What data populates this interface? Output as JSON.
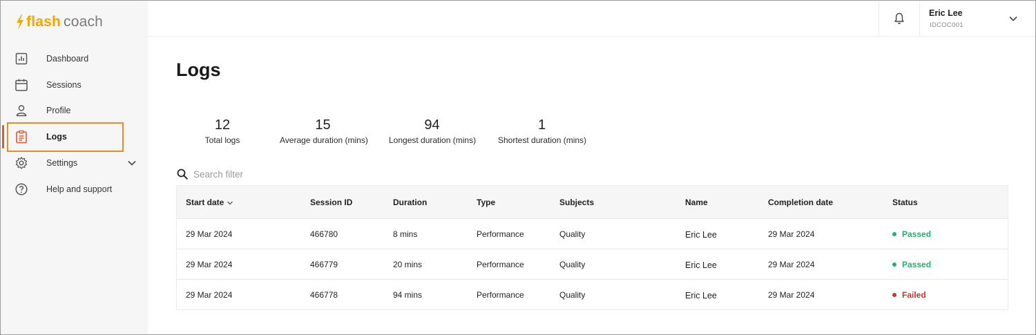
{
  "app": {
    "logo_flash": "flash",
    "logo_coach": "coach",
    "brand_color": "#f5a400"
  },
  "sidebar": {
    "items": [
      {
        "label": "Dashboard",
        "icon": "bar-chart-icon"
      },
      {
        "label": "Sessions",
        "icon": "calendar-icon"
      },
      {
        "label": "Profile",
        "icon": "person-icon"
      },
      {
        "label": "Logs",
        "icon": "clipboard-icon",
        "active": true
      },
      {
        "label": "Settings",
        "icon": "gear-icon",
        "expandable": true
      },
      {
        "label": "Help and support",
        "icon": "help-circle-icon"
      }
    ],
    "active_color": "#e2572b"
  },
  "header": {
    "user_name": "Eric Lee",
    "user_id": "IDCOC001"
  },
  "page": {
    "title": "Logs"
  },
  "stats": [
    {
      "value": "12",
      "label": "Total logs"
    },
    {
      "value": "15",
      "label": "Average duration (mins)"
    },
    {
      "value": "94",
      "label": "Longest duration (mins)"
    },
    {
      "value": "1",
      "label": "Shortest duration (mins)"
    }
  ],
  "search": {
    "placeholder": "Search filter"
  },
  "table": {
    "columns": [
      "Start date",
      "Session ID",
      "Duration",
      "Type",
      "Subjects",
      "Name",
      "Completion date",
      "Status"
    ],
    "rows": [
      {
        "start_date": "29 Mar 2024",
        "session_id": "466780",
        "duration": "8 mins",
        "type": "Performance",
        "subjects": "Quality",
        "name": "Eric Lee",
        "completion_date": "29 Mar 2024",
        "status": "Passed"
      },
      {
        "start_date": "29 Mar 2024",
        "session_id": "466779",
        "duration": "20 mins",
        "type": "Performance",
        "subjects": "Quality",
        "name": "Eric Lee",
        "completion_date": "29 Mar 2024",
        "status": "Passed"
      },
      {
        "start_date": "29 Mar 2024",
        "session_id": "466778",
        "duration": "94 mins",
        "type": "Performance",
        "subjects": "Quality",
        "name": "Eric Lee",
        "completion_date": "29 Mar 2024",
        "status": "Failed"
      }
    ],
    "status_colors": {
      "Passed": "#1db36b",
      "Failed": "#c0392b"
    }
  }
}
